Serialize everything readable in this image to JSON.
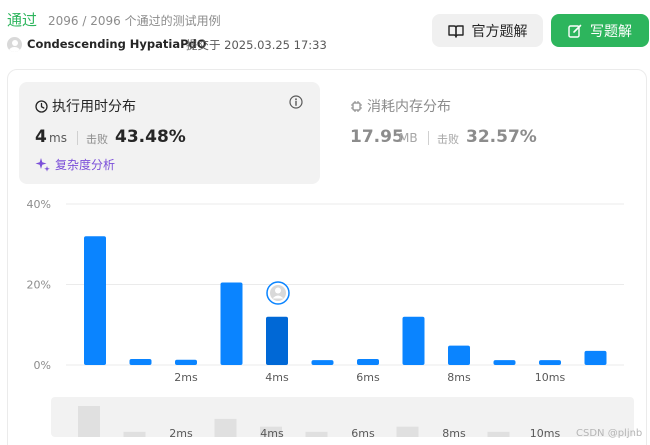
{
  "header": {
    "status": "通过",
    "cases": "2096 / 2096 个通过的测试用例",
    "author": "Condescending HypatiaPdO",
    "submitted": "提交于 2025.03.25 17:33",
    "official_button": "官方题解",
    "write_button": "写题解"
  },
  "runtime": {
    "title": "执行用时分布",
    "value": "4",
    "unit": "ms",
    "beat_label": "击败",
    "beat": "43.48%",
    "complexity": "复杂度分析"
  },
  "memory": {
    "title": "消耗内存分布",
    "value": "17.95",
    "unit": "MB",
    "beat_label": "击败",
    "beat": "32.57%"
  },
  "watermark": "CSDN @pljnb",
  "colors": {
    "accent_green": "#2db55d",
    "bar": "#0a84ff",
    "bar_current": "#0068d6",
    "navigator_bar": "#e0e0e0"
  },
  "icons": {
    "official": "book-icon",
    "write": "edit-icon",
    "runtime": "clock-icon",
    "info": "info-icon",
    "complexity": "sparkle-icon",
    "memory": "chip-icon"
  },
  "chart_data": {
    "type": "bar",
    "values": [
      32,
      1.5,
      1.3,
      20.5,
      12,
      1.2,
      1.5,
      12,
      4.8,
      1.2,
      1.2,
      3.5
    ],
    "current_index": 4,
    "x_tick_labels": [
      "2ms",
      "4ms",
      "6ms",
      "8ms",
      "10ms"
    ],
    "y_tick_labels": [
      "40%",
      "20%",
      "0%"
    ],
    "ylim": [
      0,
      40
    ],
    "grid": true,
    "navigator_values": [
      6,
      1,
      0,
      3.5,
      2,
      1,
      0,
      2,
      0,
      1,
      0,
      0
    ]
  }
}
